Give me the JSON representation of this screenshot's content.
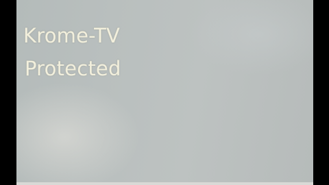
{
  "screen": {
    "line_1": "Krome-TV",
    "line_2": "Protected"
  },
  "colors": {
    "screen_background": "#b9bfbe",
    "text": "#f2efdc",
    "frame": "#000000"
  }
}
